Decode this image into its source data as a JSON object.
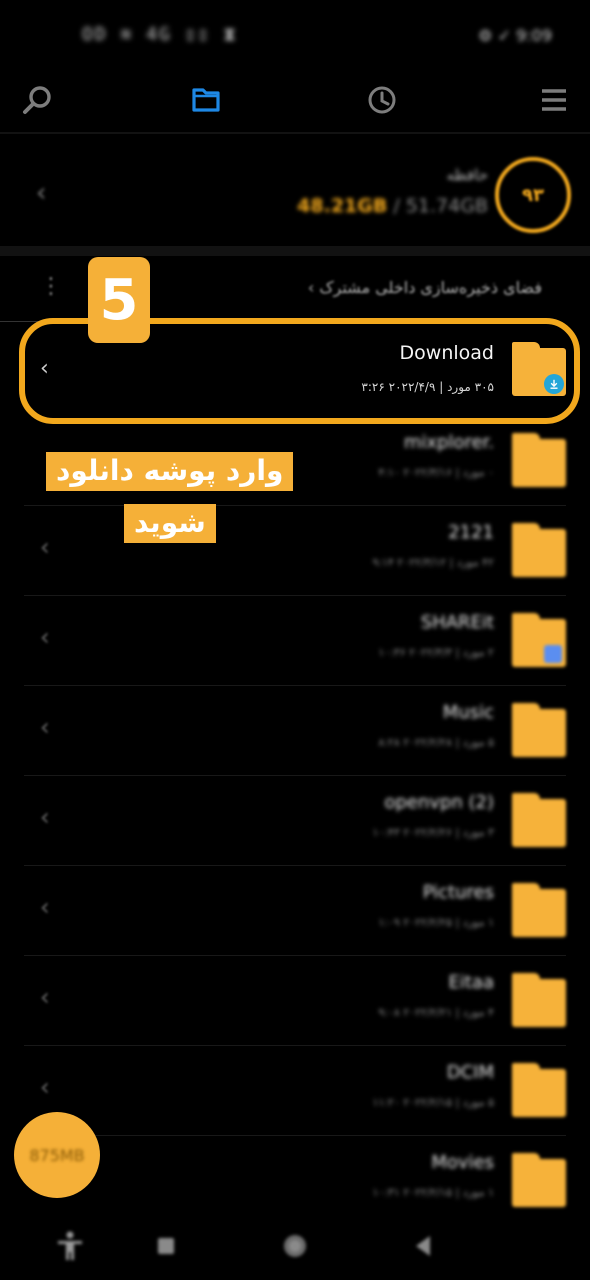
{
  "status_bar": {
    "left_text": "OD ≋ 4G ▯▯ ⧗",
    "right_text": "⚙ ✓ 9:09"
  },
  "toolbar": {
    "icons": [
      "search-icon",
      "folder-icon",
      "recent-icon",
      "menu-icon"
    ],
    "active_color": "#1e88e5",
    "icon_color": "#7d7d7d"
  },
  "storage": {
    "title": "حافظه",
    "used": "48.21GB",
    "total": " / 51.74GB",
    "percent_label": "۹۳"
  },
  "path": {
    "text": "فضای ذخیره‌سازی داخلی مشترک ›",
    "more": "⋮"
  },
  "files": [
    {
      "name": "Download",
      "meta": "۳۰۵ مورد  |  ۲۰۲۲/۴/۹  ۳:۲۶"
    },
    {
      "name": "mixplorer.",
      "meta": "۰ مورد  |  ۲۰۲۲/۳/۱۶ ۴:۱۰"
    },
    {
      "name": "2121",
      "meta": "۴۲ مورد  |  ۲۰۲۲/۳/۱۲ ۹:۱۴"
    },
    {
      "name": "SHAREit",
      "meta": "۲ مورد  |  ۲۰۲۲/۳/۳ ۱۰:۳۶"
    },
    {
      "name": "Music",
      "meta": "۵ مورد  |  ۲۰۲۲/۲/۲۸ ۸:۲۸"
    },
    {
      "name": "openvpn (2)",
      "meta": "۳ مورد  |  ۲۰۲۲/۲/۲۶ ۱۰:۴۳"
    },
    {
      "name": "Pictures",
      "meta": "۱ مورد  |  ۲۰۲۲/۲/۲۵ ۱:۰۹"
    },
    {
      "name": "Eitaa",
      "meta": "۴ مورد  |  ۲۰۲۲/۲/۲۱ ۹:۰۸"
    },
    {
      "name": "DCIM",
      "meta": "۵ مورد  |  ۲۰۲۲/۲/۱۵ ۱۱:۲۰"
    },
    {
      "name": "Movies",
      "meta": "۱ مورد  |  ۲۰۲۲/۲/۱۵ ۱۰:۳۱"
    }
  ],
  "overlay": {
    "step_number": "5",
    "instruction_line1": "وارد پوشه دانلود",
    "instruction_line2": "شوید",
    "accent_color": "#f5b038"
  },
  "fab": {
    "label": "875MB"
  },
  "navbar": {
    "icons": [
      "accessibility-icon",
      "recents-square-icon",
      "home-circle-icon",
      "back-triangle-icon"
    ]
  }
}
